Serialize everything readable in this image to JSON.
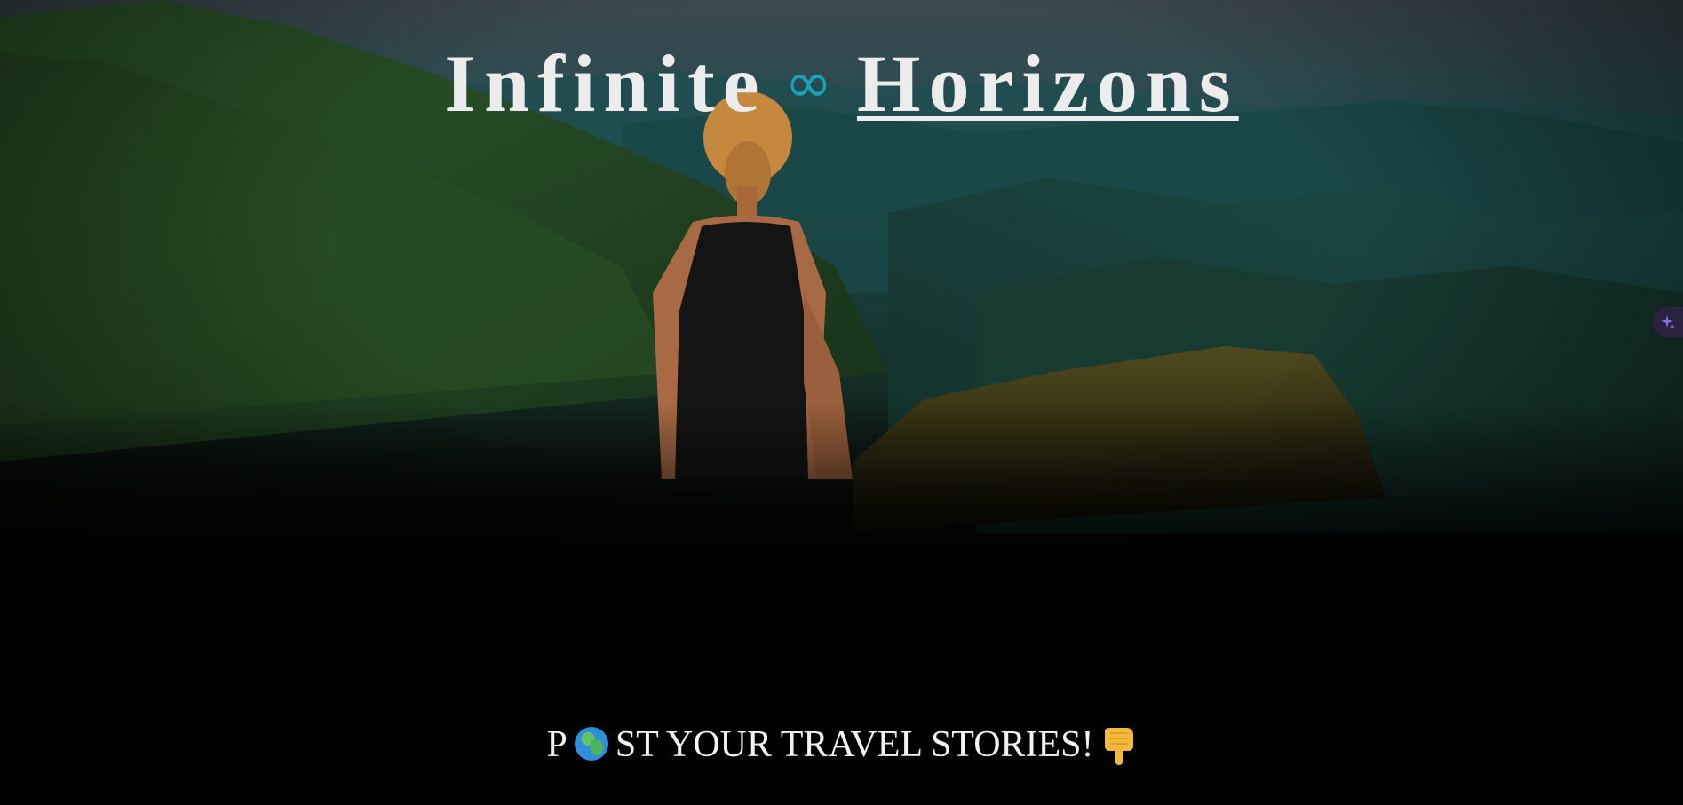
{
  "header": {
    "title_part1": "Infinite",
    "title_symbol": "∞",
    "title_part2": "Horizons",
    "symbol_color": "#1aa3b5"
  },
  "hero": {
    "image_icon": "mountain-landscape-person"
  },
  "cta": {
    "prefix": "P",
    "globe_icon": "globe-africa-emoji",
    "text": "ST YOUR TRAVEL STORIES!",
    "pointer_icon": "backhand-index-pointing-down-emoji"
  },
  "side_widget": {
    "icon": "sparkle-icon",
    "color": "#8a6fd6"
  }
}
